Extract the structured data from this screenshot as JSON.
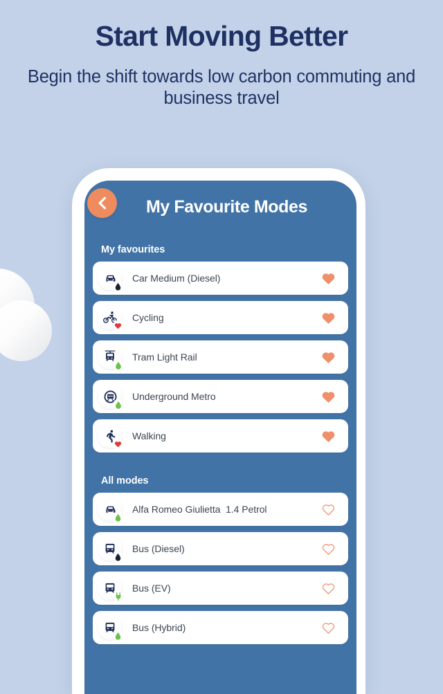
{
  "hero": {
    "title": "Start Moving Better",
    "subtitle": "Begin the shift towards low carbon commuting and business travel"
  },
  "colors": {
    "page_background": "#c3d2e8",
    "hero_text": "#1f3163",
    "phone_frame": "#ffffff",
    "screen_blue": "#4273a6",
    "accent_orange": "#ee8c60",
    "heart_filled": "#ef8f6b",
    "heart_outline": "#ef8f6b",
    "row_background": "#ffffff",
    "row_text": "#3c4552",
    "icon_navy": "#22305a",
    "badge_green": "#6cc24a",
    "badge_red": "#e03b3b",
    "badge_dark": "#1b2333"
  },
  "app": {
    "back_button": {
      "icon": "chevron-left-icon",
      "label": "Back"
    },
    "title": "My Favourite Modes",
    "sections": [
      {
        "id": "my-favourites",
        "label": "My favourites",
        "rows": [
          {
            "label": "Car Medium (Diesel)",
            "icon": "car-icon",
            "badge": "fuel-drop-dark-icon",
            "favourite": true
          },
          {
            "label": "Cycling",
            "icon": "cycling-icon",
            "badge": "heart-health-icon",
            "favourite": true
          },
          {
            "label": "Tram Light Rail",
            "icon": "tram-icon",
            "badge": "leaf-green-icon",
            "favourite": true
          },
          {
            "label": "Underground Metro",
            "icon": "metro-icon",
            "badge": "leaf-green-icon",
            "favourite": true
          },
          {
            "label": "Walking",
            "icon": "walking-icon",
            "badge": "heart-health-icon",
            "favourite": true
          }
        ]
      },
      {
        "id": "all-modes",
        "label": "All modes",
        "rows": [
          {
            "label": "Alfa Romeo Giulietta  1.4 Petrol",
            "icon": "car-icon",
            "badge": "fuel-drop-green-icon",
            "favourite": false
          },
          {
            "label": "Bus (Diesel)",
            "icon": "bus-icon",
            "badge": "fuel-drop-dark-icon",
            "favourite": false
          },
          {
            "label": "Bus (EV)",
            "icon": "bus-icon",
            "badge": "plug-green-icon",
            "favourite": false
          },
          {
            "label": "Bus (Hybrid)",
            "icon": "bus-icon",
            "badge": "fuel-drop-green-icon",
            "favourite": false
          }
        ]
      }
    ]
  }
}
